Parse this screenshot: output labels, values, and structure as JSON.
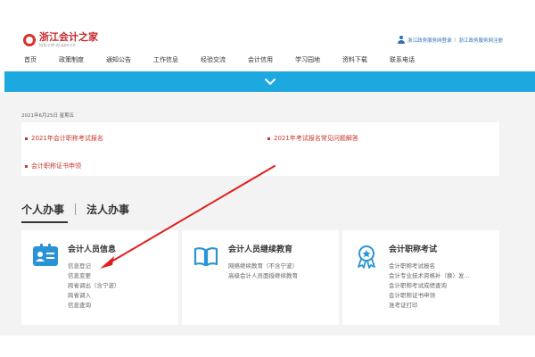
{
  "header": {
    "logo_title": "浙江会计之家",
    "logo_sub": "kjzj.czt.zj.gov.cn",
    "link1": "浙江政务服务网登录",
    "link2": "浙江政务服务网注册",
    "link_sep": "|"
  },
  "nav": [
    "首页",
    "政策制度",
    "通知公告",
    "工作信息",
    "经验交流",
    "会计信用",
    "学习园地",
    "资料下载",
    "联系电话"
  ],
  "date": "2021年6月25日 星期五",
  "notices": {
    "item1": "2021年会计职称考试报名",
    "item2": "会计职称证书申领",
    "item3": "2021年考试报名常见问题解答"
  },
  "tabs": {
    "personal": "个人办事",
    "legal": "法人办事"
  },
  "cards": [
    {
      "title": "会计人员信息",
      "lines": [
        "信息登记",
        "信息变更",
        "跨省调出（含宁波）",
        "跨省调入",
        "信息查询"
      ]
    },
    {
      "title": "会计人员继续教育",
      "lines": [
        "网络继续教育（不含宁波）",
        "高级会计人员面授继续教育"
      ]
    },
    {
      "title": "会计职称考试",
      "lines": [
        "会计职称考试报名",
        "会计专业技术资格补（换）发...",
        "会计职称考试成绩查询",
        "会计职称证书申领",
        "准考证打印"
      ]
    }
  ],
  "colors": {
    "accent_blue": "#1ea8e0",
    "notice_red": "#c9352f",
    "arrow_red": "#e02020"
  },
  "icons": {
    "user": "user-icon",
    "chevron": "chevron-down-icon",
    "card1": "id-card-icon",
    "card2": "open-book-icon",
    "card3": "award-badge-icon"
  }
}
